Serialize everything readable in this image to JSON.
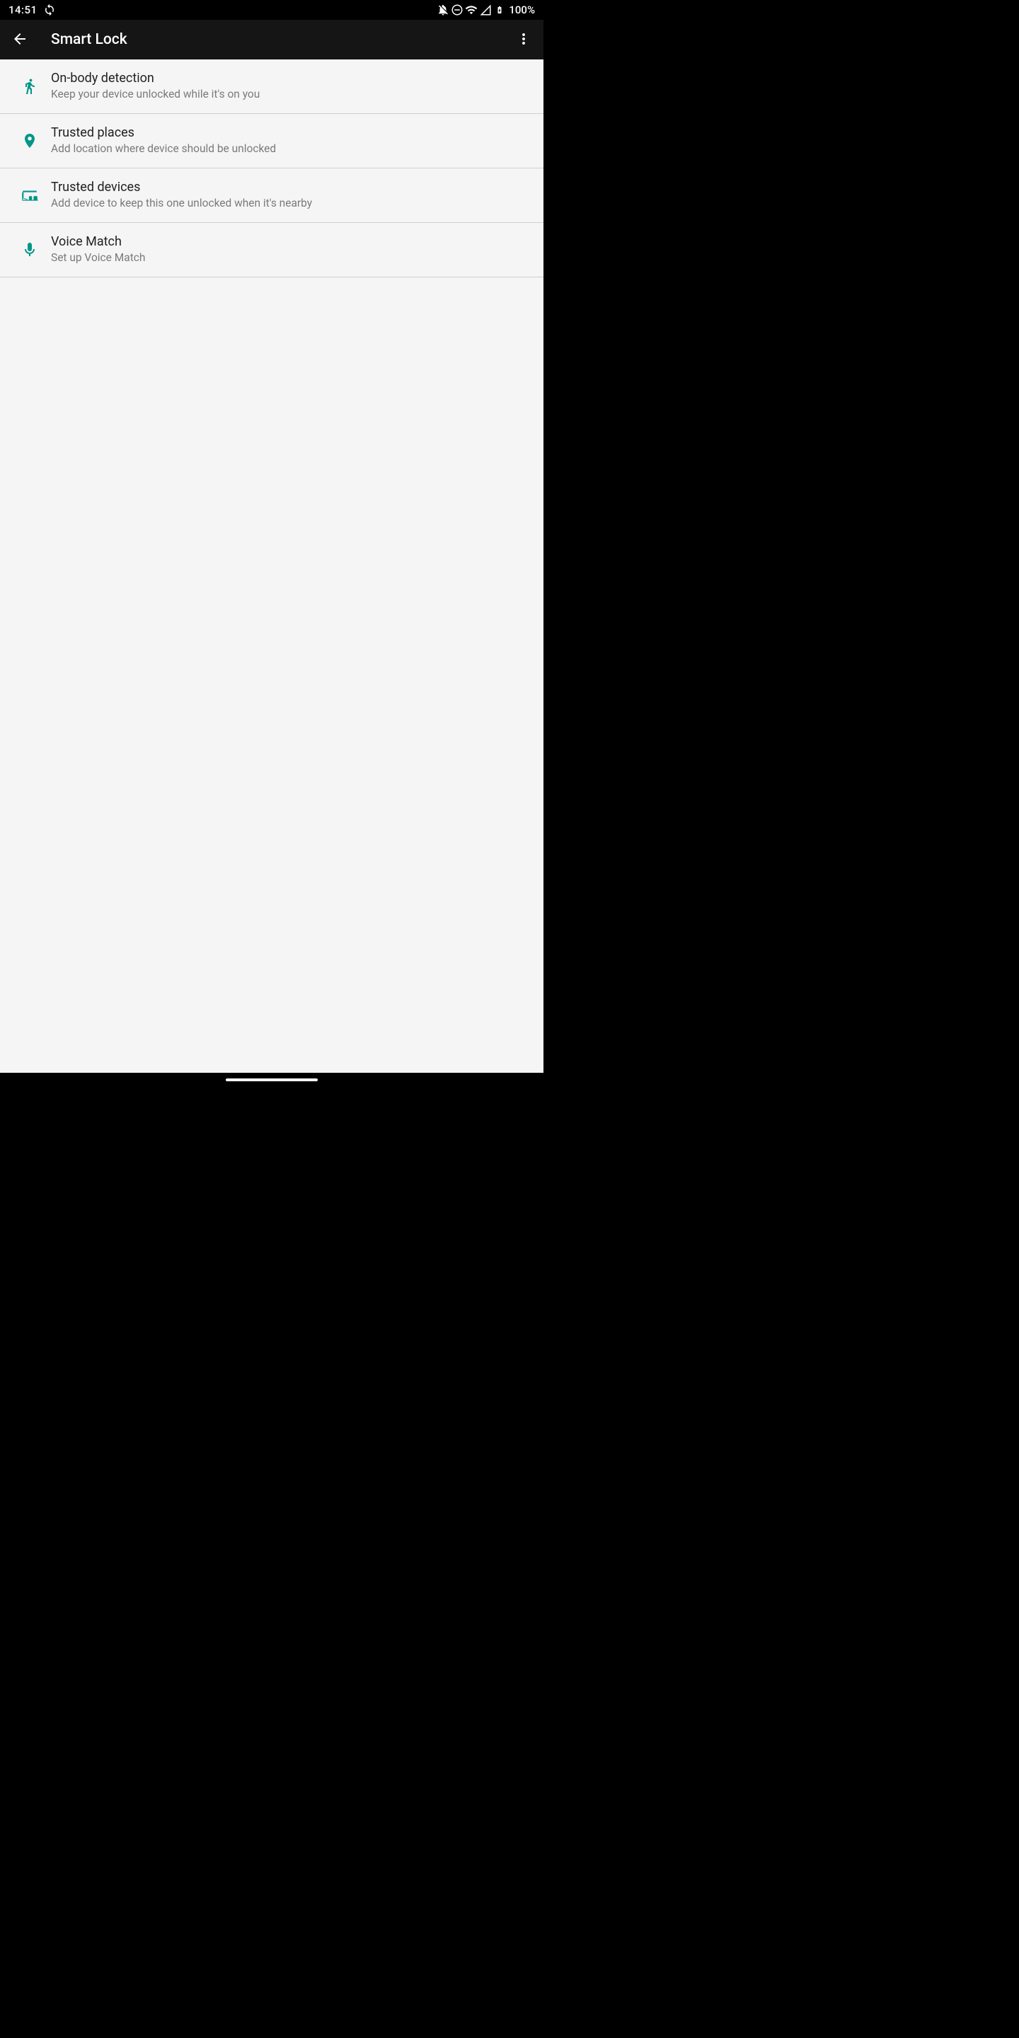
{
  "status": {
    "time": "14:51",
    "battery": "100%"
  },
  "appbar": {
    "title": "Smart Lock"
  },
  "items": [
    {
      "title": "On-body detection",
      "subtitle": "Keep your device unlocked while it's on you"
    },
    {
      "title": "Trusted places",
      "subtitle": "Add location where device should be unlocked"
    },
    {
      "title": "Trusted devices",
      "subtitle": "Add device to keep this one unlocked when it's nearby"
    },
    {
      "title": "Voice Match",
      "subtitle": "Set up Voice Match"
    }
  ],
  "colors": {
    "accent": "#009688"
  }
}
